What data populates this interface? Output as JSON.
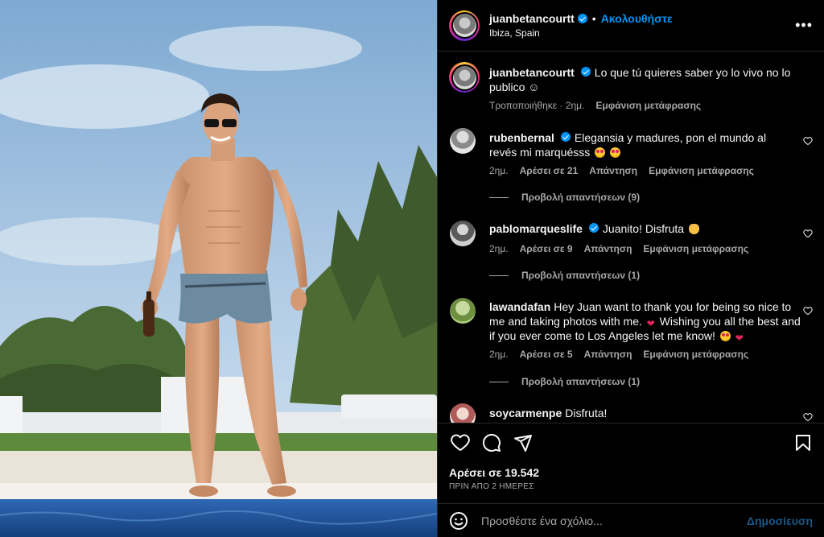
{
  "post": {
    "username": "juanbetancourtt",
    "follow_label": "Ακολουθήστε",
    "location": "Ibiza, Spain",
    "more_icon": "more-horizontal-icon",
    "dot": "•"
  },
  "caption": {
    "username": "juanbetancourtt",
    "text": "Lo que tú quieres saber yo lo vivo no lo publico ☺",
    "edited": "Τροποποιήθηκε",
    "time": "2ημ.",
    "translation": "Εμφάνιση μετάφρασης"
  },
  "comments": [
    {
      "username": "rubenbernal",
      "text": "Elegansia y madures, pon el mundo al revés mi marquésss",
      "time": "2ημ.",
      "likes": "Αρέσει σε 21",
      "reply": "Απάντηση",
      "translation": "Εμφάνιση μετάφρασης",
      "view_replies": "Προβολή απαντήσεων (9)"
    },
    {
      "username": "pablomarqueslife",
      "text": "Juanito! Disfruta",
      "time": "2ημ.",
      "likes": "Αρέσει σε 9",
      "reply": "Απάντηση",
      "translation": "Εμφάνιση μετάφρασης",
      "view_replies": "Προβολή απαντήσεων (1)"
    },
    {
      "username": "lawandafan",
      "text": "Hey Juan want to thank you for being so nice to me and taking photos with me.",
      "text2": "Wishing you all the best and if you ever come to Los Angeles let me know!",
      "time": "2ημ.",
      "likes": "Αρέσει σε 5",
      "reply": "Απάντηση",
      "translation": "Εμφάνιση μετάφρασης",
      "view_replies": "Προβολή απαντήσεων (1)"
    },
    {
      "username": "soycarmenpe",
      "text": "Disfruta!"
    }
  ],
  "footer": {
    "likes": "Αρέσει σε 19.542",
    "date": "ΠΡΙΝ ΑΠΟ 2 ΗΜΕΡΕΣ",
    "comment_placeholder": "Προσθέστε ένα σχόλιο...",
    "post_label": "Δημοσίευση"
  },
  "colors": {
    "accent": "#0095f6",
    "background": "#000000",
    "text": "#f5f5f5",
    "secondary": "#a8a8a8",
    "like_red": "#e0245e"
  }
}
